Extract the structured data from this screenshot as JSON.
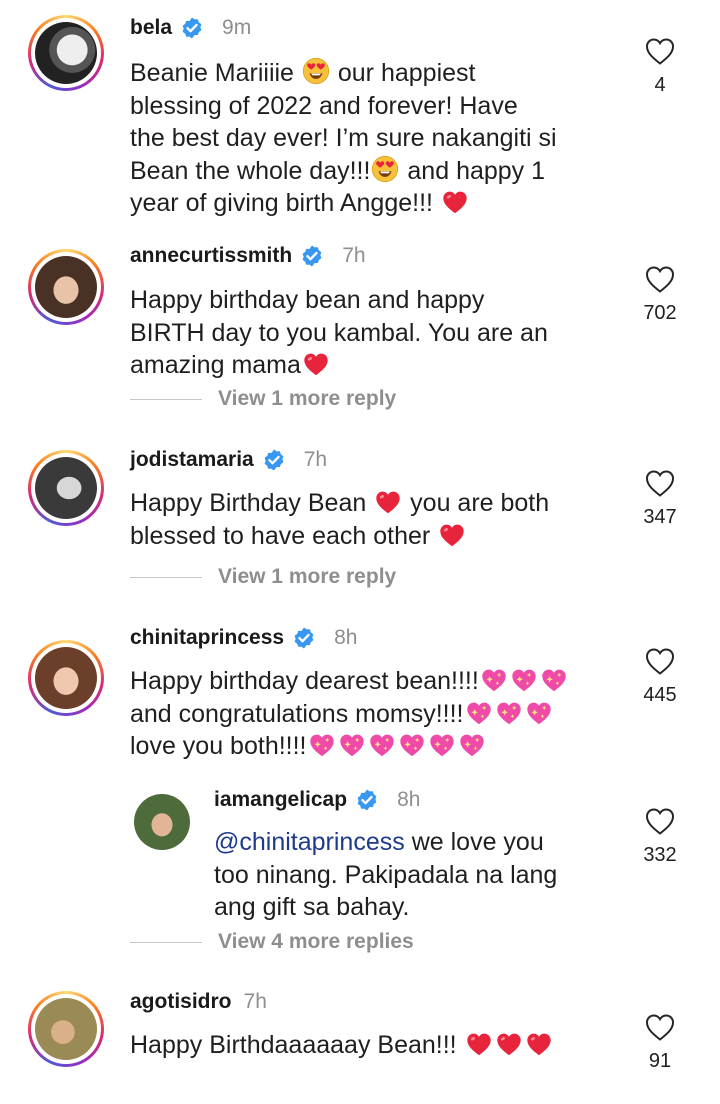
{
  "colors": {
    "accent": "#3897f0",
    "muted": "#8e8e8e",
    "heart": "#e8243c"
  },
  "comments": [
    {
      "username": "bela",
      "time": "9m",
      "likes": "4",
      "lines": [
        "Beanie Mariiiie",
        "our happiest",
        "blessing of 2022 and forever! Have",
        "the best day ever! I’m sure nakangiti si",
        "Bean the whole day!!!",
        "and happy 1",
        "year of giving birth Angge!!!"
      ]
    },
    {
      "username": "annecurtissmith",
      "time": "7h",
      "likes": "702",
      "lines": [
        "Happy birthday bean and happy",
        "BIRTH day to you kambal.  You are an",
        "amazing mama"
      ],
      "replies": "View 1 more reply"
    },
    {
      "username": "jodistamaria",
      "time": "7h",
      "likes": "347",
      "lines": [
        "Happy Birthday Bean",
        "you are both",
        "blessed to have each other"
      ],
      "replies": "View 1 more reply"
    },
    {
      "username": "chinitaprincess",
      "time": "8h",
      "likes": "445",
      "lines": [
        "Happy birthday dearest bean!!!!",
        "and congratulations momsy!!!!",
        "love you both!!!!"
      ]
    },
    {
      "username": "iamangelicap",
      "time": "8h",
      "likes": "332",
      "mention": "@chinitaprincess",
      "lines": [
        "we love you",
        "too ninang. Pakipadala na lang",
        "ang gift sa bahay."
      ],
      "replies": "View 4 more replies"
    },
    {
      "username": "agotisidro",
      "time": "7h",
      "likes": "91",
      "lines": [
        "Happy Birthdaaaaaay Bean!!!"
      ]
    }
  ]
}
